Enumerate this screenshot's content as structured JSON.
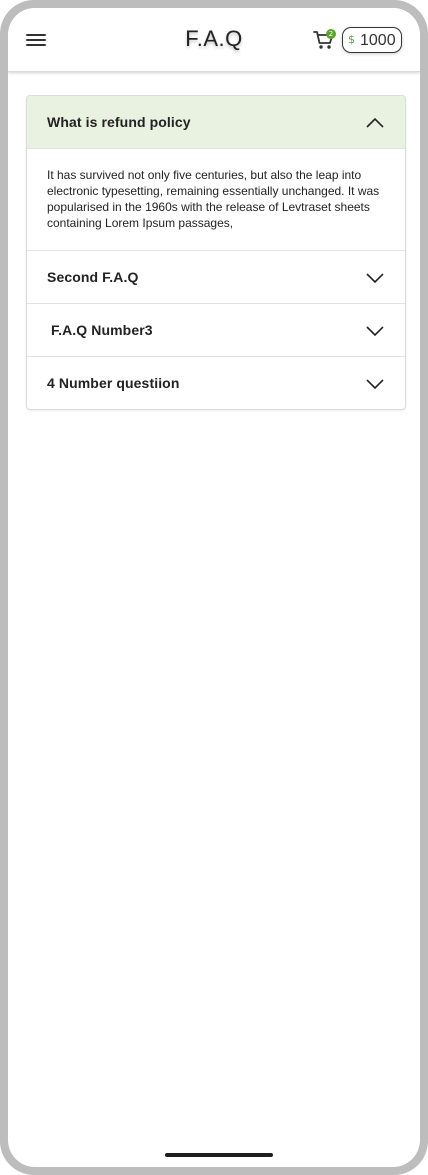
{
  "header": {
    "title": "F.A.Q",
    "menu_icon": "hamburger-menu-icon",
    "cart_icon": "shopping-cart-icon",
    "cart_badge": "2",
    "coin_icon": "coin-icon",
    "coin_symbol": "$",
    "coin_balance": "1000"
  },
  "faq": {
    "items": [
      {
        "question": "What is refund policy",
        "expanded": true,
        "answer": "It has survived not only five centuries, but also the leap into electronic typesetting, remaining essentially unchanged. It was popularised in the 1960s with the release of Levtraset sheets containing Lorem Ipsum passages,"
      },
      {
        "question": "Second F.A.Q",
        "expanded": false
      },
      {
        "question": " F.A.Q Number3",
        "expanded": false
      },
      {
        "question": "4 Number questiion",
        "expanded": false
      }
    ]
  },
  "colors": {
    "accent_green": "#5aa52a",
    "open_header_bg": "#e9f2e1"
  }
}
